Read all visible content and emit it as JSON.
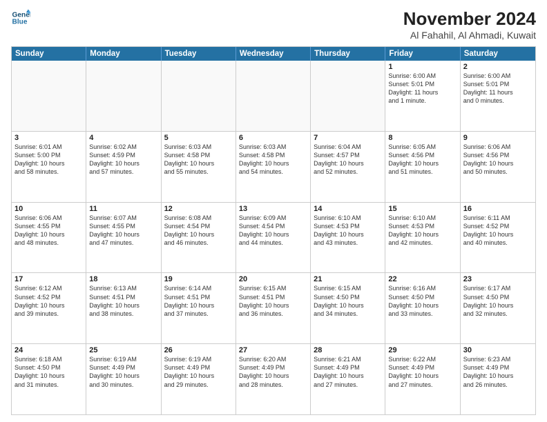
{
  "logo": {
    "line1": "General",
    "line2": "Blue"
  },
  "title": "November 2024",
  "subtitle": "Al Fahahil, Al Ahmadi, Kuwait",
  "columns": [
    "Sunday",
    "Monday",
    "Tuesday",
    "Wednesday",
    "Thursday",
    "Friday",
    "Saturday"
  ],
  "weeks": [
    [
      {
        "num": "",
        "info": ""
      },
      {
        "num": "",
        "info": ""
      },
      {
        "num": "",
        "info": ""
      },
      {
        "num": "",
        "info": ""
      },
      {
        "num": "",
        "info": ""
      },
      {
        "num": "1",
        "info": "Sunrise: 6:00 AM\nSunset: 5:01 PM\nDaylight: 11 hours\nand 1 minute."
      },
      {
        "num": "2",
        "info": "Sunrise: 6:00 AM\nSunset: 5:01 PM\nDaylight: 11 hours\nand 0 minutes."
      }
    ],
    [
      {
        "num": "3",
        "info": "Sunrise: 6:01 AM\nSunset: 5:00 PM\nDaylight: 10 hours\nand 58 minutes."
      },
      {
        "num": "4",
        "info": "Sunrise: 6:02 AM\nSunset: 4:59 PM\nDaylight: 10 hours\nand 57 minutes."
      },
      {
        "num": "5",
        "info": "Sunrise: 6:03 AM\nSunset: 4:58 PM\nDaylight: 10 hours\nand 55 minutes."
      },
      {
        "num": "6",
        "info": "Sunrise: 6:03 AM\nSunset: 4:58 PM\nDaylight: 10 hours\nand 54 minutes."
      },
      {
        "num": "7",
        "info": "Sunrise: 6:04 AM\nSunset: 4:57 PM\nDaylight: 10 hours\nand 52 minutes."
      },
      {
        "num": "8",
        "info": "Sunrise: 6:05 AM\nSunset: 4:56 PM\nDaylight: 10 hours\nand 51 minutes."
      },
      {
        "num": "9",
        "info": "Sunrise: 6:06 AM\nSunset: 4:56 PM\nDaylight: 10 hours\nand 50 minutes."
      }
    ],
    [
      {
        "num": "10",
        "info": "Sunrise: 6:06 AM\nSunset: 4:55 PM\nDaylight: 10 hours\nand 48 minutes."
      },
      {
        "num": "11",
        "info": "Sunrise: 6:07 AM\nSunset: 4:55 PM\nDaylight: 10 hours\nand 47 minutes."
      },
      {
        "num": "12",
        "info": "Sunrise: 6:08 AM\nSunset: 4:54 PM\nDaylight: 10 hours\nand 46 minutes."
      },
      {
        "num": "13",
        "info": "Sunrise: 6:09 AM\nSunset: 4:54 PM\nDaylight: 10 hours\nand 44 minutes."
      },
      {
        "num": "14",
        "info": "Sunrise: 6:10 AM\nSunset: 4:53 PM\nDaylight: 10 hours\nand 43 minutes."
      },
      {
        "num": "15",
        "info": "Sunrise: 6:10 AM\nSunset: 4:53 PM\nDaylight: 10 hours\nand 42 minutes."
      },
      {
        "num": "16",
        "info": "Sunrise: 6:11 AM\nSunset: 4:52 PM\nDaylight: 10 hours\nand 40 minutes."
      }
    ],
    [
      {
        "num": "17",
        "info": "Sunrise: 6:12 AM\nSunset: 4:52 PM\nDaylight: 10 hours\nand 39 minutes."
      },
      {
        "num": "18",
        "info": "Sunrise: 6:13 AM\nSunset: 4:51 PM\nDaylight: 10 hours\nand 38 minutes."
      },
      {
        "num": "19",
        "info": "Sunrise: 6:14 AM\nSunset: 4:51 PM\nDaylight: 10 hours\nand 37 minutes."
      },
      {
        "num": "20",
        "info": "Sunrise: 6:15 AM\nSunset: 4:51 PM\nDaylight: 10 hours\nand 36 minutes."
      },
      {
        "num": "21",
        "info": "Sunrise: 6:15 AM\nSunset: 4:50 PM\nDaylight: 10 hours\nand 34 minutes."
      },
      {
        "num": "22",
        "info": "Sunrise: 6:16 AM\nSunset: 4:50 PM\nDaylight: 10 hours\nand 33 minutes."
      },
      {
        "num": "23",
        "info": "Sunrise: 6:17 AM\nSunset: 4:50 PM\nDaylight: 10 hours\nand 32 minutes."
      }
    ],
    [
      {
        "num": "24",
        "info": "Sunrise: 6:18 AM\nSunset: 4:50 PM\nDaylight: 10 hours\nand 31 minutes."
      },
      {
        "num": "25",
        "info": "Sunrise: 6:19 AM\nSunset: 4:49 PM\nDaylight: 10 hours\nand 30 minutes."
      },
      {
        "num": "26",
        "info": "Sunrise: 6:19 AM\nSunset: 4:49 PM\nDaylight: 10 hours\nand 29 minutes."
      },
      {
        "num": "27",
        "info": "Sunrise: 6:20 AM\nSunset: 4:49 PM\nDaylight: 10 hours\nand 28 minutes."
      },
      {
        "num": "28",
        "info": "Sunrise: 6:21 AM\nSunset: 4:49 PM\nDaylight: 10 hours\nand 27 minutes."
      },
      {
        "num": "29",
        "info": "Sunrise: 6:22 AM\nSunset: 4:49 PM\nDaylight: 10 hours\nand 27 minutes."
      },
      {
        "num": "30",
        "info": "Sunrise: 6:23 AM\nSunset: 4:49 PM\nDaylight: 10 hours\nand 26 minutes."
      }
    ]
  ]
}
